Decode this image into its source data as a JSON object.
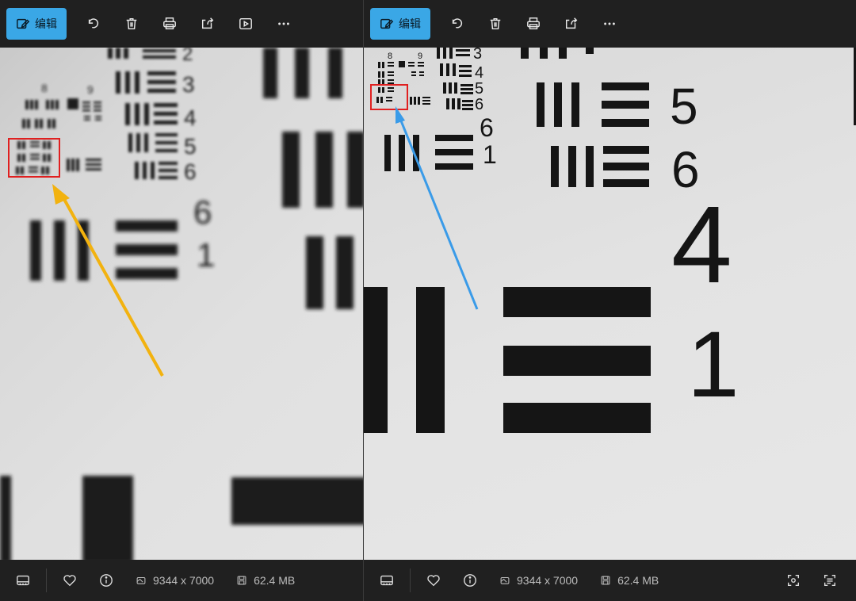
{
  "left_viewer": {
    "toolbar": {
      "edit_label": "编辑",
      "icons": [
        "edit-icon",
        "rotate-icon",
        "delete-icon",
        "print-icon",
        "share-icon",
        "slideshow-icon",
        "more-icon"
      ]
    },
    "chart_labels": {
      "g8": "8",
      "g9": "9",
      "n2": "2",
      "n3": "3",
      "n4": "4",
      "n5": "5",
      "n6": "6",
      "big6": "6",
      "big1": "1"
    },
    "status": {
      "dimensions": "9344 x 7000",
      "size": "62.4 MB"
    },
    "arrow_color": "#f2b20f",
    "highlight_color": "#e02020"
  },
  "right_viewer": {
    "toolbar": {
      "edit_label": "编辑",
      "icons": [
        "edit-icon",
        "rotate-icon",
        "delete-icon",
        "print-icon",
        "share-icon",
        "more-icon"
      ]
    },
    "chart_labels": {
      "g8": "8",
      "g9": "9",
      "n3": "3",
      "n4": "4",
      "n5": "5",
      "n6": "6",
      "small6": "6",
      "small1": "1",
      "big4": "4",
      "big5": "5",
      "big6": "6",
      "huge4": "4",
      "huge1": "1"
    },
    "status": {
      "dimensions": "9344 x 7000",
      "size": "62.4 MB"
    },
    "arrow_color": "#3a9be8",
    "highlight_color": "#e02020"
  },
  "toolbar_accent": "#3aa7e6"
}
